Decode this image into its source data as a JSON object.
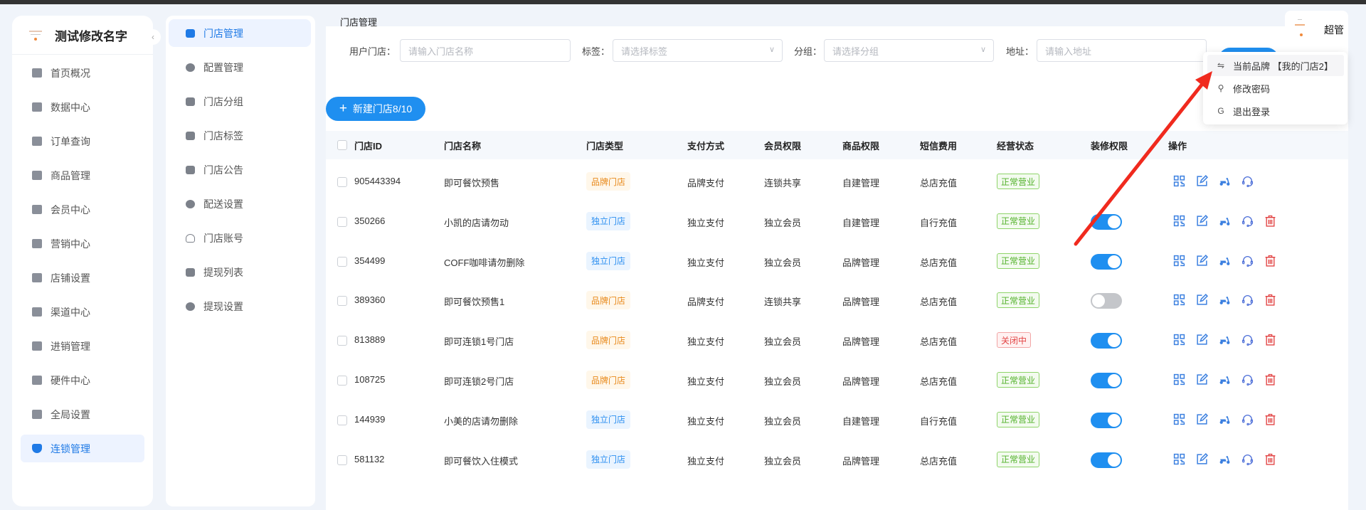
{
  "sidebar": {
    "brand": "测试修改名字",
    "items": [
      {
        "label": "首页概况"
      },
      {
        "label": "数据中心"
      },
      {
        "label": "订单查询"
      },
      {
        "label": "商品管理"
      },
      {
        "label": "会员中心"
      },
      {
        "label": "营销中心"
      },
      {
        "label": "店铺设置"
      },
      {
        "label": "渠道中心"
      },
      {
        "label": "进销管理"
      },
      {
        "label": "硬件中心"
      },
      {
        "label": "全局设置"
      },
      {
        "label": "连锁管理",
        "active": true
      }
    ]
  },
  "submenu": {
    "items": [
      {
        "label": "门店管理",
        "active": true,
        "icon": "store-icon"
      },
      {
        "label": "配置管理",
        "icon": "gear-icon"
      },
      {
        "label": "门店分组",
        "icon": "store-icon"
      },
      {
        "label": "门店标签",
        "icon": "tag-icon"
      },
      {
        "label": "门店公告",
        "icon": "message-icon"
      },
      {
        "label": "配送设置",
        "icon": "gear-icon"
      },
      {
        "label": "门店账号",
        "icon": "user-icon"
      },
      {
        "label": "提现列表",
        "icon": "clipboard-icon"
      },
      {
        "label": "提现设置",
        "icon": "gear-icon"
      }
    ]
  },
  "page": {
    "title": "门店管理"
  },
  "filters": {
    "store_label": "用户门店：",
    "store_placeholder": "请输入门店名称",
    "tag_label": "标签：",
    "tag_placeholder": "请选择标签",
    "group_label": "分组：",
    "group_placeholder": "请选择分组",
    "address_label": "地址：",
    "address_placeholder": "请输入地址"
  },
  "new_button": {
    "label": "新建门店8/10"
  },
  "table": {
    "columns": [
      "门店ID",
      "门店名称",
      "门店类型",
      "支付方式",
      "会员权限",
      "商品权限",
      "短信费用",
      "经营状态",
      "装修权限",
      "操作"
    ],
    "rows": [
      {
        "id": "905443394",
        "name": "即可餐饮预售",
        "type": "品牌门店",
        "pay": "品牌支付",
        "member": "连锁共享",
        "goods": "自建管理",
        "sms": "总店充值",
        "status": "正常营业",
        "decor": null,
        "delete": false
      },
      {
        "id": "350266",
        "name": "小凯的店请勿动",
        "type": "独立门店",
        "pay": "独立支付",
        "member": "独立会员",
        "goods": "自建管理",
        "sms": "自行充值",
        "status": "正常营业",
        "decor": true,
        "delete": true
      },
      {
        "id": "354499",
        "name": "COFF咖啡请勿删除",
        "type": "独立门店",
        "pay": "独立支付",
        "member": "独立会员",
        "goods": "品牌管理",
        "sms": "总店充值",
        "status": "正常营业",
        "decor": true,
        "delete": true
      },
      {
        "id": "389360",
        "name": "即可餐饮预售1",
        "type": "品牌门店",
        "pay": "品牌支付",
        "member": "连锁共享",
        "goods": "品牌管理",
        "sms": "总店充值",
        "status": "正常营业",
        "decor": false,
        "delete": true
      },
      {
        "id": "813889",
        "name": "即可连锁1号门店",
        "type": "品牌门店",
        "pay": "独立支付",
        "member": "独立会员",
        "goods": "品牌管理",
        "sms": "总店充值",
        "status": "关闭中",
        "decor": true,
        "delete": true
      },
      {
        "id": "108725",
        "name": "即可连锁2号门店",
        "type": "品牌门店",
        "pay": "独立支付",
        "member": "独立会员",
        "goods": "品牌管理",
        "sms": "总店充值",
        "status": "正常营业",
        "decor": true,
        "delete": true
      },
      {
        "id": "144939",
        "name": "小美的店请勿删除",
        "type": "独立门店",
        "pay": "独立支付",
        "member": "独立会员",
        "goods": "自建管理",
        "sms": "自行充值",
        "status": "正常营业",
        "decor": true,
        "delete": true
      },
      {
        "id": "581132",
        "name": "即可餐饮入住模式",
        "type": "独立门店",
        "pay": "独立支付",
        "member": "独立会员",
        "goods": "品牌管理",
        "sms": "总店充值",
        "status": "正常营业",
        "decor": true,
        "delete": true
      }
    ]
  },
  "user": {
    "name": "超管"
  },
  "dropdown": {
    "items": [
      {
        "label": "当前品牌 【我的门店2】",
        "icon": "switch-icon"
      },
      {
        "label": "修改密码",
        "icon": "key-icon"
      },
      {
        "label": "退出登录",
        "icon": "logout-icon"
      }
    ]
  },
  "colors": {
    "accent": "#1f8ff0",
    "danger": "#e24545",
    "success": "#52b12a",
    "warning": "#e8891a",
    "annotation": "#f02a1e"
  }
}
